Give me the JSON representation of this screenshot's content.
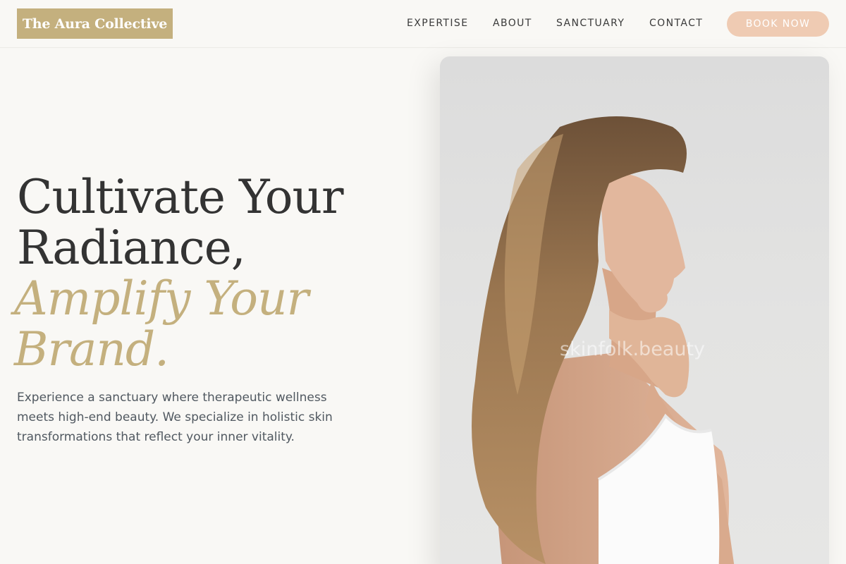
{
  "header": {
    "logo": "The Aura Collective",
    "nav": [
      {
        "label": "EXPERTISE"
      },
      {
        "label": "ABOUT"
      },
      {
        "label": "SANCTUARY"
      },
      {
        "label": "CONTACT"
      }
    ],
    "cta_label": "BOOK NOW"
  },
  "hero": {
    "title_line1": "Cultivate Your",
    "title_line2": "Radiance,",
    "title_line3": "Amplify Your",
    "title_line4": "Brand.",
    "description": "Experience a sanctuary where therapeutic wellness meets high-end beauty. We specialize in holistic skin transformations that reflect your inner vitality.",
    "image_watermark": "skinfolk.beauty"
  },
  "colors": {
    "background": "#f9f8f5",
    "gold_accent": "#c4b07e",
    "cta_peach": "#efcbb3",
    "text_dark": "#333333",
    "text_body": "#505860"
  }
}
